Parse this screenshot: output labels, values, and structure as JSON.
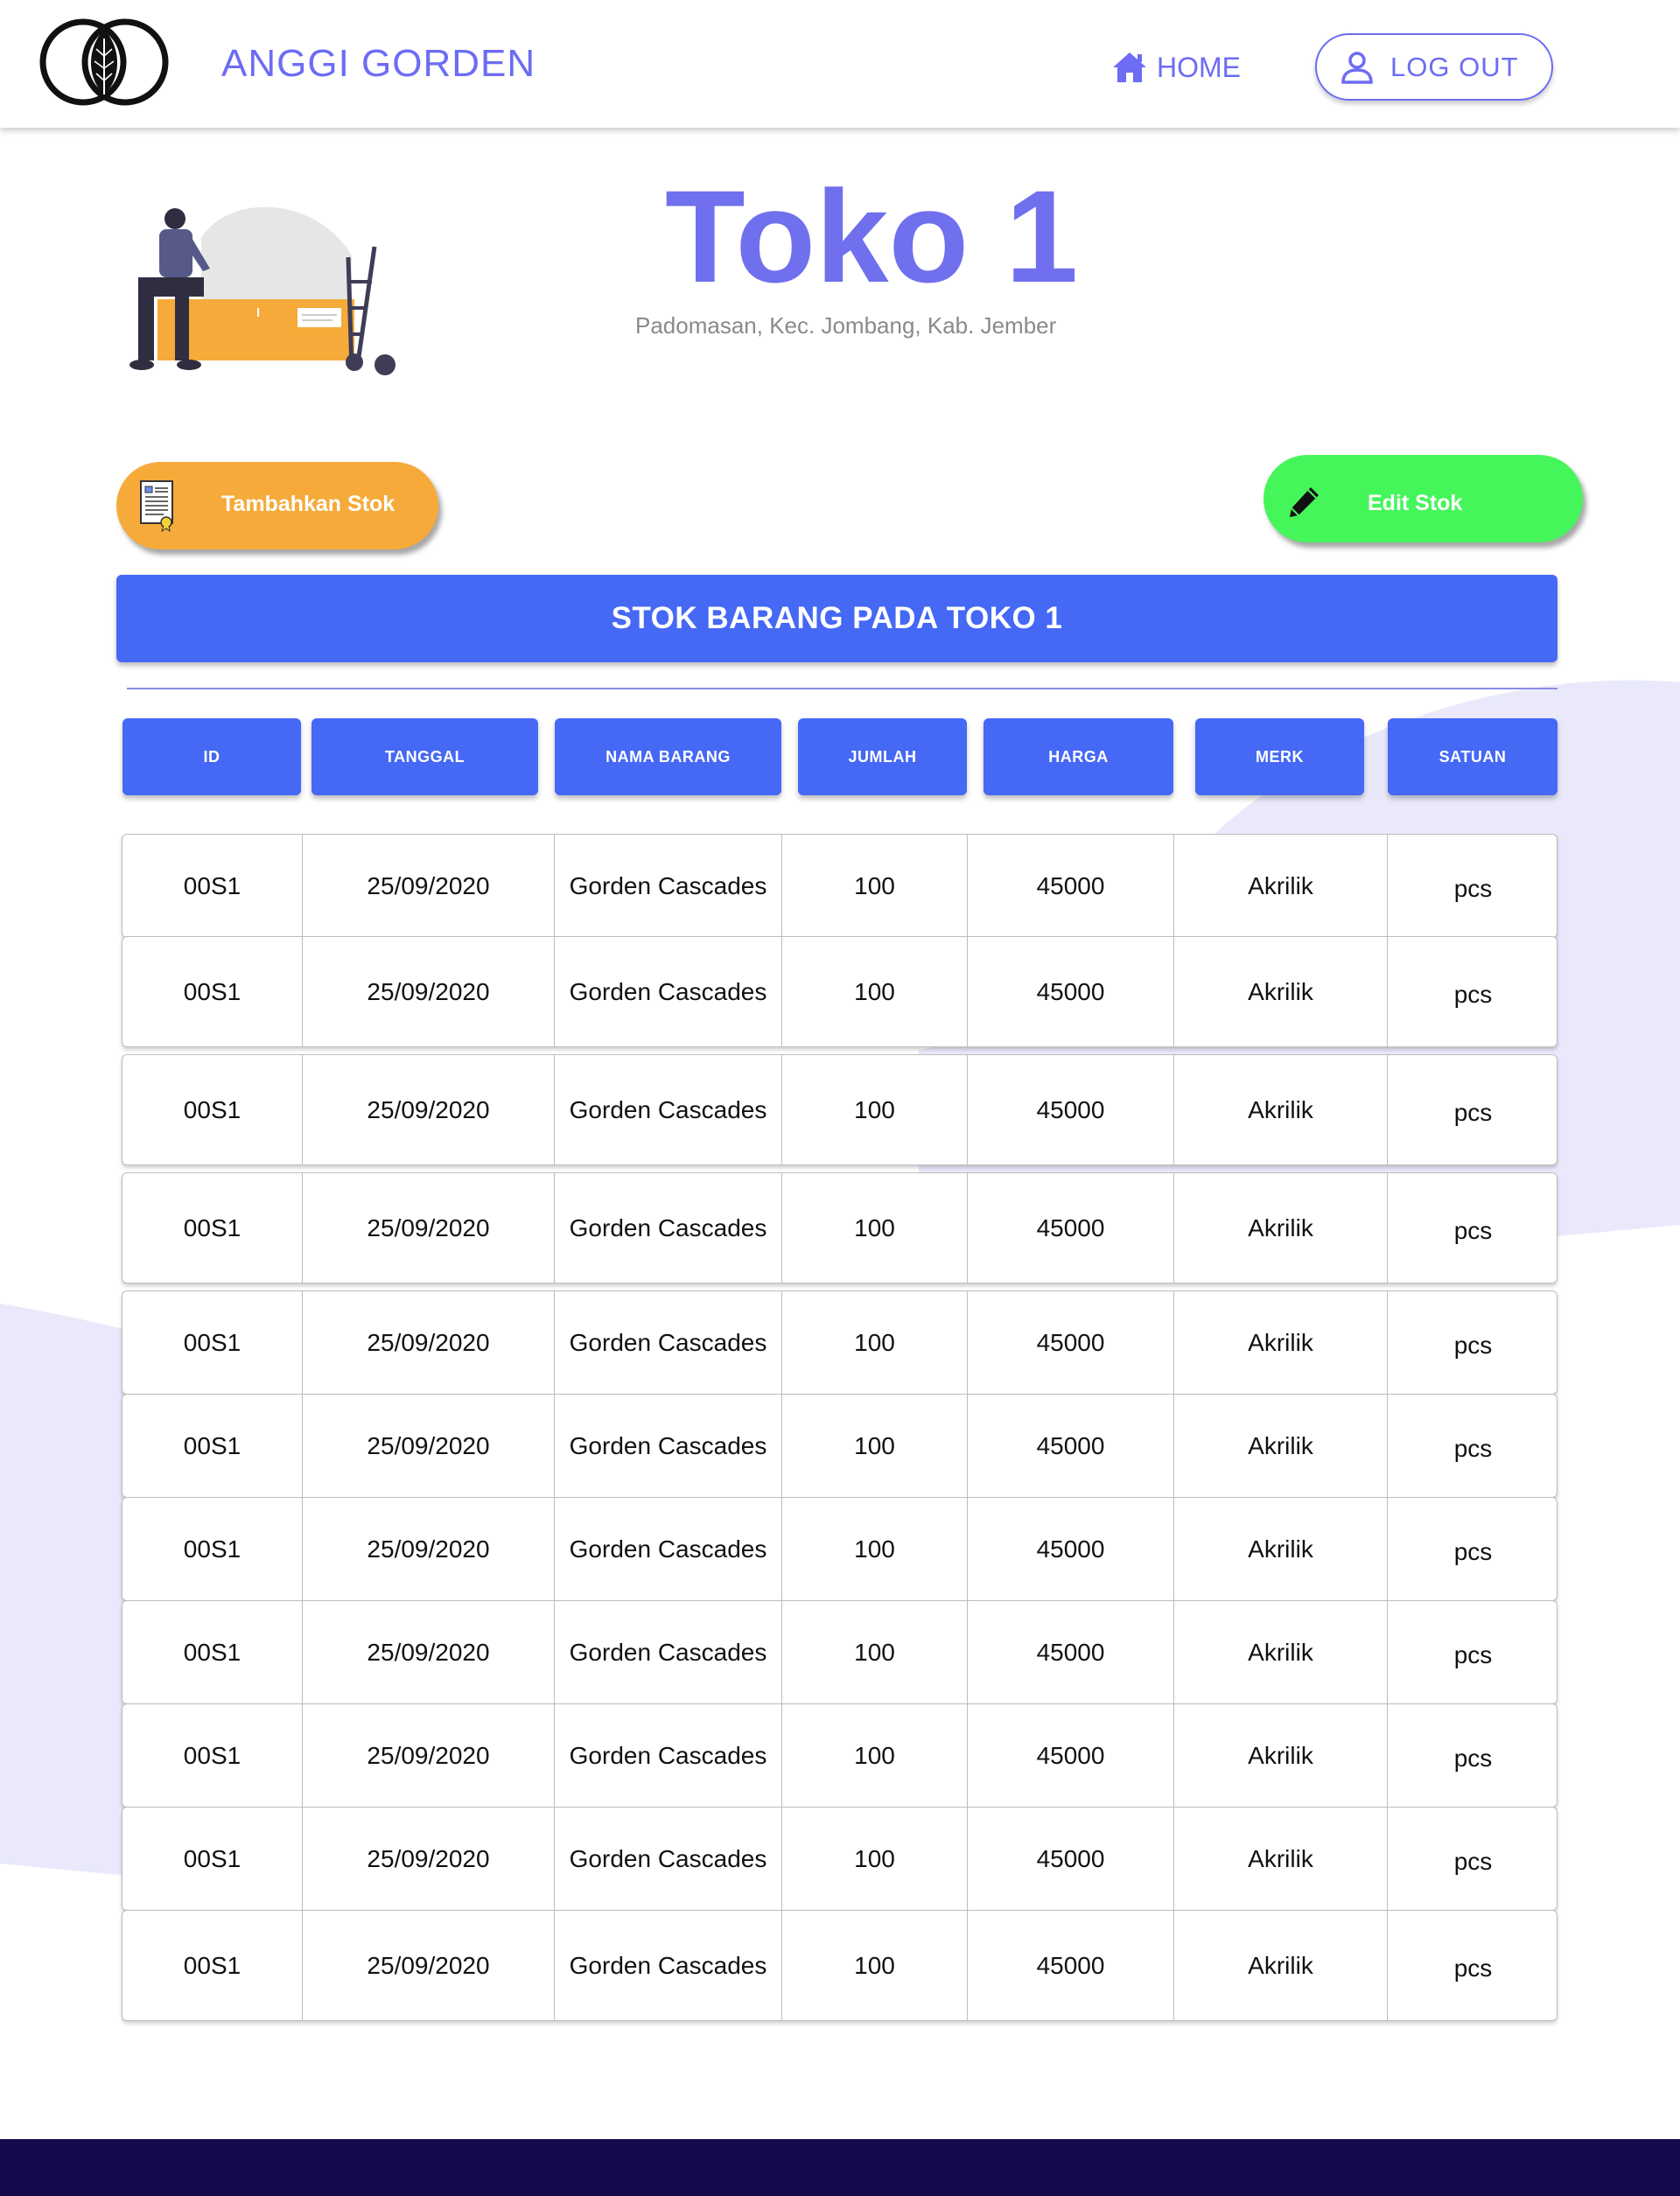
{
  "header": {
    "brand": "ANGGI GORDEN",
    "home_label": "HOME",
    "logout_label": "LOG OUT"
  },
  "store": {
    "title": "Toko 1",
    "address": "Padomasan, Kec. Jombang, Kab. Jember"
  },
  "actions": {
    "add_label": "Tambahkan Stok",
    "edit_label": "Edit Stok"
  },
  "section": {
    "title": "STOK BARANG PADA TOKO 1"
  },
  "table": {
    "columns": [
      "ID",
      "TANGGAL",
      "NAMA BARANG",
      "JUMLAH",
      "HARGA",
      "MERK",
      "SATUAN"
    ],
    "rows": [
      [
        "00S1",
        "25/09/2020",
        "Gorden Cascades",
        "100",
        "45000",
        "Akrilik",
        "pcs"
      ],
      [
        "00S1",
        "25/09/2020",
        "Gorden Cascades",
        "100",
        "45000",
        "Akrilik",
        "pcs"
      ],
      [
        "00S1",
        "25/09/2020",
        "Gorden Cascades",
        "100",
        "45000",
        "Akrilik",
        "pcs"
      ],
      [
        "00S1",
        "25/09/2020",
        "Gorden Cascades",
        "100",
        "45000",
        "Akrilik",
        "pcs"
      ],
      [
        "00S1",
        "25/09/2020",
        "Gorden Cascades",
        "100",
        "45000",
        "Akrilik",
        "pcs"
      ],
      [
        "00S1",
        "25/09/2020",
        "Gorden Cascades",
        "100",
        "45000",
        "Akrilik",
        "pcs"
      ],
      [
        "00S1",
        "25/09/2020",
        "Gorden Cascades",
        "100",
        "45000",
        "Akrilik",
        "pcs"
      ],
      [
        "00S1",
        "25/09/2020",
        "Gorden Cascades",
        "100",
        "45000",
        "Akrilik",
        "pcs"
      ],
      [
        "00S1",
        "25/09/2020",
        "Gorden Cascades",
        "100",
        "45000",
        "Akrilik",
        "pcs"
      ],
      [
        "00S1",
        "25/09/2020",
        "Gorden Cascades",
        "100",
        "45000",
        "Akrilik",
        "pcs"
      ],
      [
        "00S1",
        "25/09/2020",
        "Gorden Cascades",
        "100",
        "45000",
        "Akrilik",
        "pcs"
      ]
    ]
  },
  "colors": {
    "accent": "#6C6CF4",
    "primary_blue": "#4568F5",
    "add_orange": "#F6AA3A",
    "edit_green": "#45F65B",
    "footer_navy": "#140B4E",
    "blob_lavender": "#E9E9FB"
  },
  "icons": {
    "logo": "leaf-rings-logo",
    "home": "home-icon",
    "logout": "user-icon",
    "add": "document-icon",
    "edit": "pencil-icon"
  }
}
